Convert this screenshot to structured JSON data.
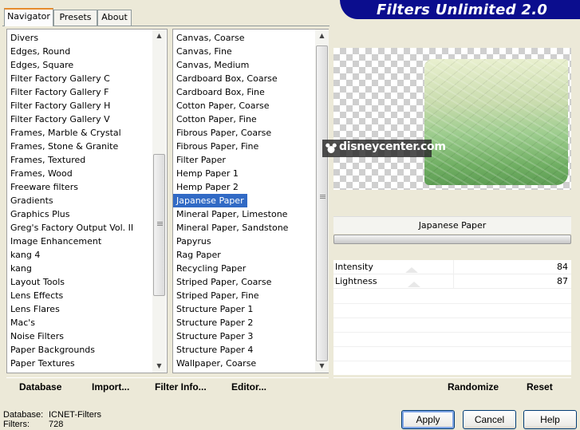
{
  "tabs": [
    {
      "label": "Navigator",
      "active": true
    },
    {
      "label": "Presets",
      "active": false
    },
    {
      "label": "About",
      "active": false
    }
  ],
  "banner": {
    "title": "Filters Unlimited 2.0",
    "color": "#0b0d8e"
  },
  "categories": {
    "items": [
      "Divers",
      "Edges, Round",
      "Edges, Square",
      "Filter Factory Gallery C",
      "Filter Factory Gallery F",
      "Filter Factory Gallery H",
      "Filter Factory Gallery V",
      "Frames, Marble & Crystal",
      "Frames, Stone & Granite",
      "Frames, Textured",
      "Frames, Wood",
      "Freeware filters",
      "Gradients",
      "Graphics Plus",
      "Greg's Factory Output Vol. II",
      "Image Enhancement",
      "kang 4",
      "kang",
      "Layout Tools",
      "Lens Effects",
      "Lens Flares",
      "Mac's",
      "Noise Filters",
      "Paper Backgrounds",
      "Paper Textures"
    ]
  },
  "filters": {
    "items": [
      "Canvas, Coarse",
      "Canvas, Fine",
      "Canvas, Medium",
      "Cardboard Box, Coarse",
      "Cardboard Box, Fine",
      "Cotton Paper, Coarse",
      "Cotton Paper, Fine",
      "Fibrous Paper, Coarse",
      "Fibrous Paper, Fine",
      "Filter Paper",
      "Hemp Paper 1",
      "Hemp Paper 2",
      "Japanese Paper",
      "Mineral Paper, Limestone",
      "Mineral Paper, Sandstone",
      "Papyrus",
      "Rag Paper",
      "Recycling Paper",
      "Striped Paper, Coarse",
      "Striped Paper, Fine",
      "Structure Paper 1",
      "Structure Paper 2",
      "Structure Paper 3",
      "Structure Paper 4",
      "Wallpaper, Coarse"
    ],
    "selected_index": 12,
    "selected_color": "#316ac5"
  },
  "preview": {
    "watermark": "disneycenter.com"
  },
  "selected_filter_name": "Japanese Paper",
  "params": [
    {
      "label": "Intensity",
      "value": "84",
      "level": 0.33
    },
    {
      "label": "Lightness",
      "value": "87",
      "level": 0.34
    }
  ],
  "left_toolbar": {
    "database": "Database",
    "import": "Import...",
    "filter_info": "Filter Info...",
    "editor": "Editor..."
  },
  "right_toolbar": {
    "randomize": "Randomize",
    "reset": "Reset"
  },
  "status": {
    "database_label": "Database:",
    "database_value": "ICNET-Filters",
    "filters_label": "Filters:",
    "filters_value": "728"
  },
  "buttons": {
    "apply": "Apply",
    "cancel": "Cancel",
    "help": "Help"
  }
}
